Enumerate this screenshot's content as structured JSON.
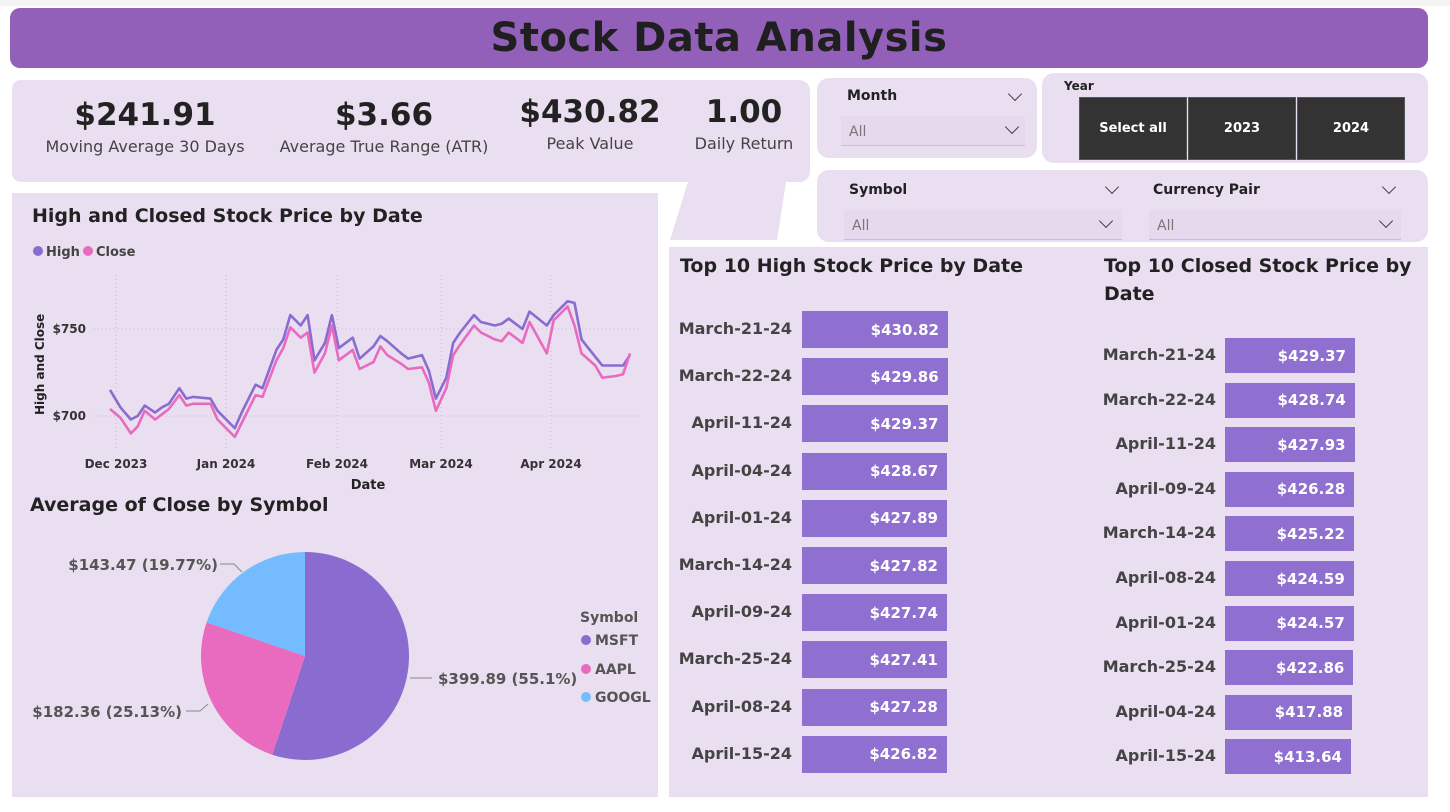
{
  "title": "Stock Data Analysis",
  "kpis": [
    {
      "value": "$241.91",
      "label": "Moving Average 30 Days"
    },
    {
      "value": "$3.66",
      "label": "Average True Range (ATR)"
    },
    {
      "value": "$430.82",
      "label": "Peak Value"
    },
    {
      "value": "1.00",
      "label": "Daily Return"
    }
  ],
  "filters": {
    "month": {
      "title": "Month",
      "value": "All"
    },
    "year": {
      "title": "Year",
      "options": [
        "Select all",
        "2023",
        "2024"
      ]
    },
    "symbol": {
      "title": "Symbol",
      "value": "All"
    },
    "currency_pair": {
      "title": "Currency Pair",
      "value": "All"
    }
  },
  "colors": {
    "high": "#8a6cd1",
    "close": "#e86bbf",
    "msft": "#8a6cd1",
    "aapl": "#e86bbf",
    "googl": "#74bcff",
    "bar": "#8f6fd0",
    "banner": "#9260b8",
    "panel": "#eadff0"
  },
  "line_chart": {
    "title": "High and Closed Stock Price by Date",
    "legend": [
      "High",
      "Close"
    ],
    "xlabel": "Date",
    "ylabel": "High and Close",
    "yticks": [
      "$750",
      "$700"
    ],
    "xticks": [
      "Dec 2023",
      "Jan 2024",
      "Feb 2024",
      "Mar 2024",
      "Apr 2024"
    ]
  },
  "pie_chart": {
    "title": "Average of Close by Symbol",
    "legend_title": "Symbol",
    "labels": {
      "msft": "$399.89 (55.1%)",
      "aapl": "$182.36 (25.13%)",
      "googl": "$143.47 (19.77%)"
    },
    "legend": [
      "MSFT",
      "AAPL",
      "GOOGL"
    ]
  },
  "top_high": {
    "title": "Top 10 High Stock Price by Date",
    "rows": [
      {
        "date": "March-21-24",
        "value": "$430.82"
      },
      {
        "date": "March-22-24",
        "value": "$429.86"
      },
      {
        "date": "April-11-24",
        "value": "$429.37"
      },
      {
        "date": "April-04-24",
        "value": "$428.67"
      },
      {
        "date": "April-01-24",
        "value": "$427.89"
      },
      {
        "date": "March-14-24",
        "value": "$427.82"
      },
      {
        "date": "April-09-24",
        "value": "$427.74"
      },
      {
        "date": "March-25-24",
        "value": "$427.41"
      },
      {
        "date": "April-08-24",
        "value": "$427.28"
      },
      {
        "date": "April-15-24",
        "value": "$426.82"
      }
    ]
  },
  "top_close": {
    "title_line1": "Top 10 Closed Stock Price by",
    "title_line2": "Date",
    "rows": [
      {
        "date": "March-21-24",
        "value": "$429.37"
      },
      {
        "date": "March-22-24",
        "value": "$428.74"
      },
      {
        "date": "April-11-24",
        "value": "$427.93"
      },
      {
        "date": "April-09-24",
        "value": "$426.28"
      },
      {
        "date": "March-14-24",
        "value": "$425.22"
      },
      {
        "date": "April-08-24",
        "value": "$424.59"
      },
      {
        "date": "April-01-24",
        "value": "$424.57"
      },
      {
        "date": "March-25-24",
        "value": "$422.86"
      },
      {
        "date": "April-04-24",
        "value": "$417.88"
      },
      {
        "date": "April-15-24",
        "value": "$413.64"
      }
    ]
  },
  "chart_data": [
    {
      "type": "line",
      "title": "High and Closed Stock Price by Date",
      "xlabel": "Date",
      "ylabel": "High and Close",
      "x": [
        "2023-11-28",
        "2023-12-01",
        "2023-12-04",
        "2023-12-06",
        "2023-12-08",
        "2023-12-11",
        "2023-12-13",
        "2023-12-15",
        "2023-12-18",
        "2023-12-20",
        "2023-12-22",
        "2023-12-27",
        "2023-12-29",
        "2024-01-03",
        "2024-01-05",
        "2024-01-09",
        "2024-01-11",
        "2024-01-15",
        "2024-01-17",
        "2024-01-19",
        "2024-01-22",
        "2024-01-24",
        "2024-01-26",
        "2024-01-29",
        "2024-01-31",
        "2024-02-02",
        "2024-02-06",
        "2024-02-08",
        "2024-02-12",
        "2024-02-14",
        "2024-02-16",
        "2024-02-20",
        "2024-02-22",
        "2024-02-26",
        "2024-02-28",
        "2024-03-01",
        "2024-03-04",
        "2024-03-06",
        "2024-03-08",
        "2024-03-12",
        "2024-03-14",
        "2024-03-18",
        "2024-03-20",
        "2024-03-22",
        "2024-03-26",
        "2024-03-28",
        "2024-04-02",
        "2024-04-04",
        "2024-04-08",
        "2024-04-10",
        "2024-04-12",
        "2024-04-16",
        "2024-04-18",
        "2024-04-22",
        "2024-04-24",
        "2024-04-26"
      ],
      "series": [
        {
          "name": "High",
          "values": [
            715,
            705,
            698,
            700,
            706,
            702,
            705,
            707,
            716,
            710,
            711,
            710,
            703,
            693,
            702,
            718,
            716,
            738,
            744,
            758,
            752,
            758,
            732,
            742,
            758,
            739,
            745,
            733,
            740,
            746,
            743,
            736,
            733,
            735,
            726,
            710,
            722,
            742,
            748,
            758,
            754,
            752,
            753,
            756,
            750,
            760,
            752,
            758,
            766,
            765,
            744,
            734,
            729,
            729,
            729,
            735
          ]
        },
        {
          "name": "Close",
          "values": [
            704,
            699,
            690,
            694,
            703,
            698,
            701,
            704,
            712,
            706,
            707,
            707,
            698,
            688,
            696,
            712,
            711,
            732,
            739,
            751,
            745,
            748,
            725,
            736,
            752,
            732,
            738,
            727,
            731,
            740,
            735,
            730,
            727,
            728,
            719,
            703,
            716,
            735,
            741,
            752,
            748,
            744,
            743,
            748,
            742,
            754,
            736,
            755,
            763,
            752,
            736,
            729,
            722,
            723,
            724,
            736
          ]
        }
      ]
    },
    {
      "type": "pie",
      "title": "Average of Close by Symbol",
      "categories": [
        "MSFT",
        "AAPL",
        "GOOGL"
      ],
      "values": [
        399.89,
        182.36,
        143.47
      ],
      "percent": [
        55.1,
        25.13,
        19.77
      ]
    },
    {
      "type": "bar",
      "title": "Top 10 High Stock Price by Date",
      "categories": [
        "March-21-24",
        "March-22-24",
        "April-11-24",
        "April-04-24",
        "April-01-24",
        "March-14-24",
        "April-09-24",
        "March-25-24",
        "April-08-24",
        "April-15-24"
      ],
      "values": [
        430.82,
        429.86,
        429.37,
        428.67,
        427.89,
        427.82,
        427.74,
        427.41,
        427.28,
        426.82
      ]
    },
    {
      "type": "bar",
      "title": "Top 10 Closed Stock Price by Date",
      "categories": [
        "March-21-24",
        "March-22-24",
        "April-11-24",
        "April-09-24",
        "March-14-24",
        "April-08-24",
        "April-01-24",
        "March-25-24",
        "April-04-24",
        "April-15-24"
      ],
      "values": [
        429.37,
        428.74,
        427.93,
        426.28,
        425.22,
        424.59,
        424.57,
        422.86,
        417.88,
        413.64
      ]
    }
  ]
}
